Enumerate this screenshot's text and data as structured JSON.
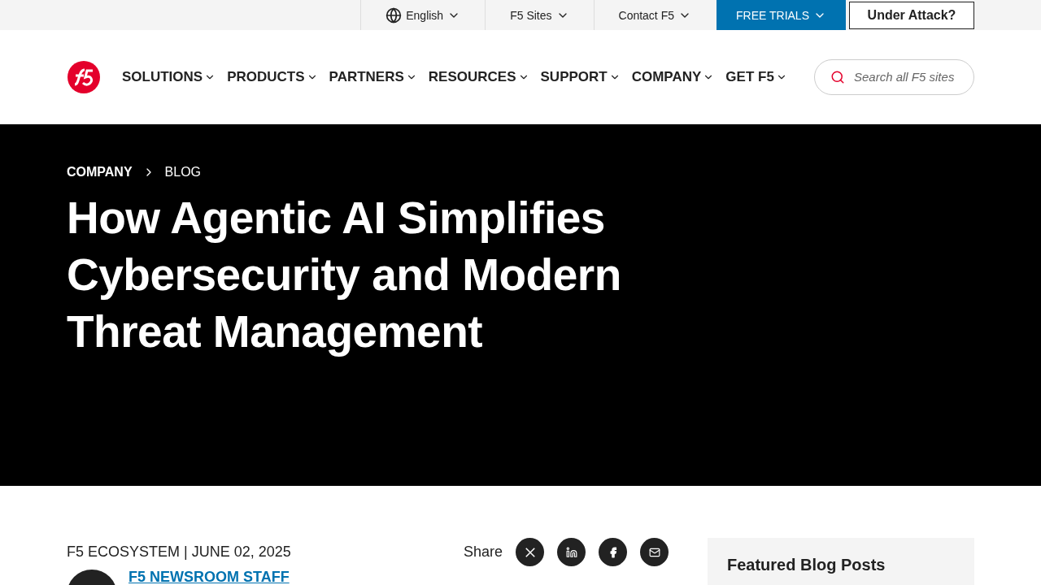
{
  "utility_bar": {
    "language": "English",
    "links": [
      {
        "label": "F5 Sites"
      },
      {
        "label": "Contact F5"
      }
    ],
    "trials": "FREE TRIALS",
    "attack_button": "Under Attack?"
  },
  "nav": {
    "items": [
      {
        "label": "SOLUTIONS"
      },
      {
        "label": "PRODUCTS"
      },
      {
        "label": "PARTNERS"
      },
      {
        "label": "RESOURCES"
      },
      {
        "label": "SUPPORT"
      },
      {
        "label": "COMPANY"
      },
      {
        "label": "GET F5"
      }
    ],
    "search": {
      "placeholder": "Search all F5 sites"
    }
  },
  "hero": {
    "breadcrumbs": [
      "COMPANY",
      "BLOG"
    ],
    "title": "How Agentic AI Simplifies Cybersecurity and Modern Threat Management"
  },
  "article": {
    "meta": "F5 ECOSYSTEM | JUNE 02, 2025",
    "share_label": "Share",
    "share_buttons": [
      {
        "kind": "x"
      },
      {
        "kind": "linkedin"
      },
      {
        "kind": "facebook"
      },
      {
        "kind": "email"
      }
    ],
    "author": "F5 NEWSROOM STAFF"
  },
  "sidebar": {
    "title": "Featured Blog Posts"
  }
}
